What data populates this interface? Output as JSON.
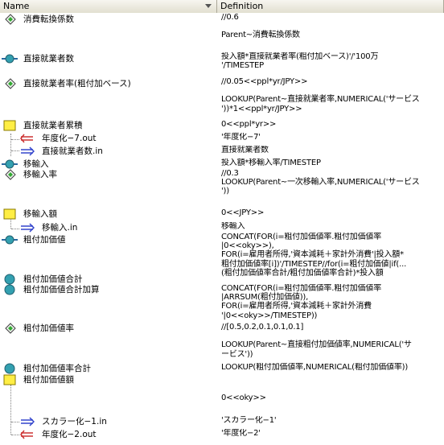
{
  "header": {
    "name": "Name",
    "definition": "Definition"
  },
  "rows": [
    {
      "icon": "diamond-icon",
      "name": "消費転換係数",
      "def": "//0.6\n\nParent~消費転換係数"
    },
    {
      "icon": "flow-icon",
      "name": "直接就業者数",
      "def": "投入額*直接就業者率(粗付加ベース)'/'100万\n'/TIMESTEP"
    },
    {
      "icon": "diamond-icon",
      "name": "直接就業者率(粗付加ベース)",
      "def": "//0.05<<ppl*yr/JPY>>\n\nLOOKUP(Parent~直接就業者率,NUMERICAL('サービス\n'))*1<<ppl*yr/JPY>>"
    },
    {
      "icon": "stock-icon",
      "name": "直接就業者累積",
      "def": "0<<ppl*yr>>"
    },
    {
      "icon": "outflow-icon",
      "name": "年度化−7.out",
      "def": "'年度化−7'"
    },
    {
      "icon": "inflow-icon",
      "name": "直接就業者数.in",
      "def": "直接就業者数"
    },
    {
      "icon": "flow-icon",
      "name": "移輸入",
      "def": "投入額*移輸入率/TIMESTEP"
    },
    {
      "icon": "diamond-icon",
      "name": "移輸入率",
      "def": "//0.3\nLOOKUP(Parent~一次移輸入率,NUMERICAL('サービス\n'))"
    },
    {
      "icon": "stock-icon",
      "name": "移輸入額",
      "def": "0<<JPY>>"
    },
    {
      "icon": "inflow-icon",
      "name": "移輸入.in",
      "def": "移輸入"
    },
    {
      "icon": "flow-icon",
      "name": "粗付加価値",
      "def": "CONCAT(FOR(i=粗付加価値率.粗付加価値率\n|0<<oky>>),\nFOR(i=雇用者所得,'資本減耗＋家計外消費'|投入額*\n粗付加価値率[i])'/TIMESTEP//for(i=粗付加価値|if(...\n(粗付加価値率合計/粗付加価値率合計)*投入額"
    },
    {
      "icon": "aux-icon",
      "name": "粗付加価値合計",
      "def": ""
    },
    {
      "icon": "aux-icon",
      "name": "粗付加価値合計加算",
      "def": "CONCAT(FOR(i=粗付加価値率.粗付加価値率\n|ARRSUM(粗付加価値)),\nFOR(i=雇用者所得,'資本減耗＋家計外消費\n'|0<<oky>>/TIMESTEP))"
    },
    {
      "icon": "diamond-icon",
      "name": "粗付加価値率",
      "def": "//[0.5,0.2,0.1,0.1,0.1]\n\nLOOKUP(Parent~直接粗付加価値率,NUMERICAL('サ\nービス'))"
    },
    {
      "icon": "aux-icon",
      "name": "粗付加価値率合計",
      "def": "LOOKUP(粗付加価値率,NUMERICAL(粗付加価値率))"
    },
    {
      "icon": "stock-icon",
      "name": "粗付加価値額",
      "def": "\n\n0<<oky>>"
    },
    {
      "icon": "inflow-icon",
      "name": "スカラー化−1.in",
      "def": "'スカラー化−1'"
    },
    {
      "icon": "outflow-icon",
      "name": "年度化−2.out",
      "def": "'年度化−2'"
    }
  ]
}
